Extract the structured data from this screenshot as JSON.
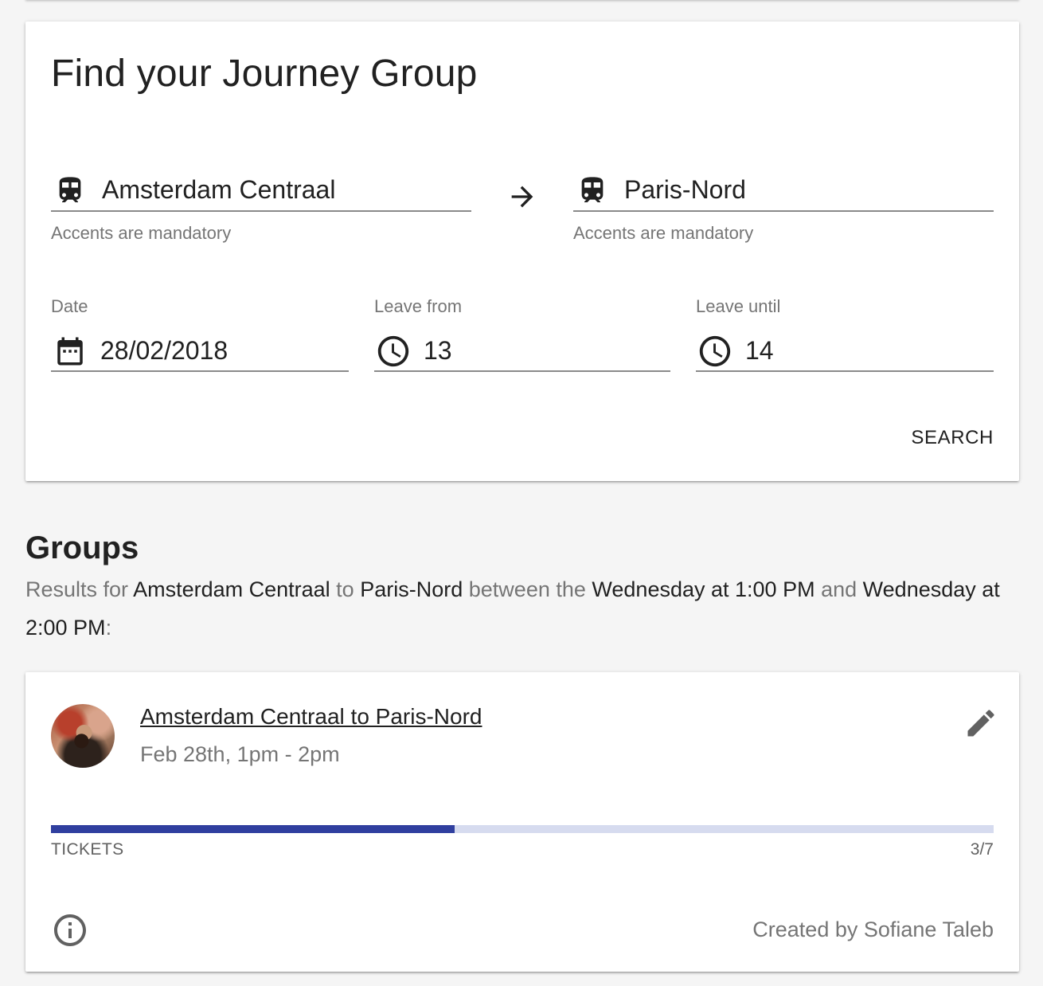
{
  "search": {
    "title": "Find your Journey Group",
    "from_station": "Amsterdam Centraal",
    "to_station": "Paris-Nord",
    "from_helper": "Accents are mandatory",
    "to_helper": "Accents are mandatory",
    "date_label": "Date",
    "date_value": "28/02/2018",
    "leave_from_label": "Leave from",
    "leave_from_value": "13",
    "leave_until_label": "Leave until",
    "leave_until_value": "14",
    "search_button": "SEARCH",
    "icons": {
      "station": "train-icon",
      "arrow": "arrow-right-icon",
      "date": "calendar-icon",
      "time": "clock-icon"
    }
  },
  "groups": {
    "title": "Groups",
    "results": {
      "prefix": "Results for",
      "from": "Amsterdam Centraal",
      "to_word": "to",
      "to": "Paris-Nord",
      "between_word": "between the",
      "start": "Wednesday at 1:00 PM",
      "and_word": "and",
      "end": "Wednesday at 2:00 PM",
      "suffix": ":"
    },
    "items": [
      {
        "title": "Amsterdam Centraal to Paris-Nord",
        "subtitle": "Feb 28th, 1pm - 2pm",
        "tickets_label": "TICKETS",
        "tickets_count": "3/7",
        "tickets_fraction": 0.4286,
        "created_by": "Created by Sofiane Taleb",
        "icons": {
          "edit": "pencil-icon",
          "info": "info-icon",
          "avatar": "avatar"
        }
      }
    ]
  },
  "colors": {
    "progress_fill": "#303f9f",
    "progress_track": "#d6dbef",
    "background": "#f5f5f5"
  }
}
